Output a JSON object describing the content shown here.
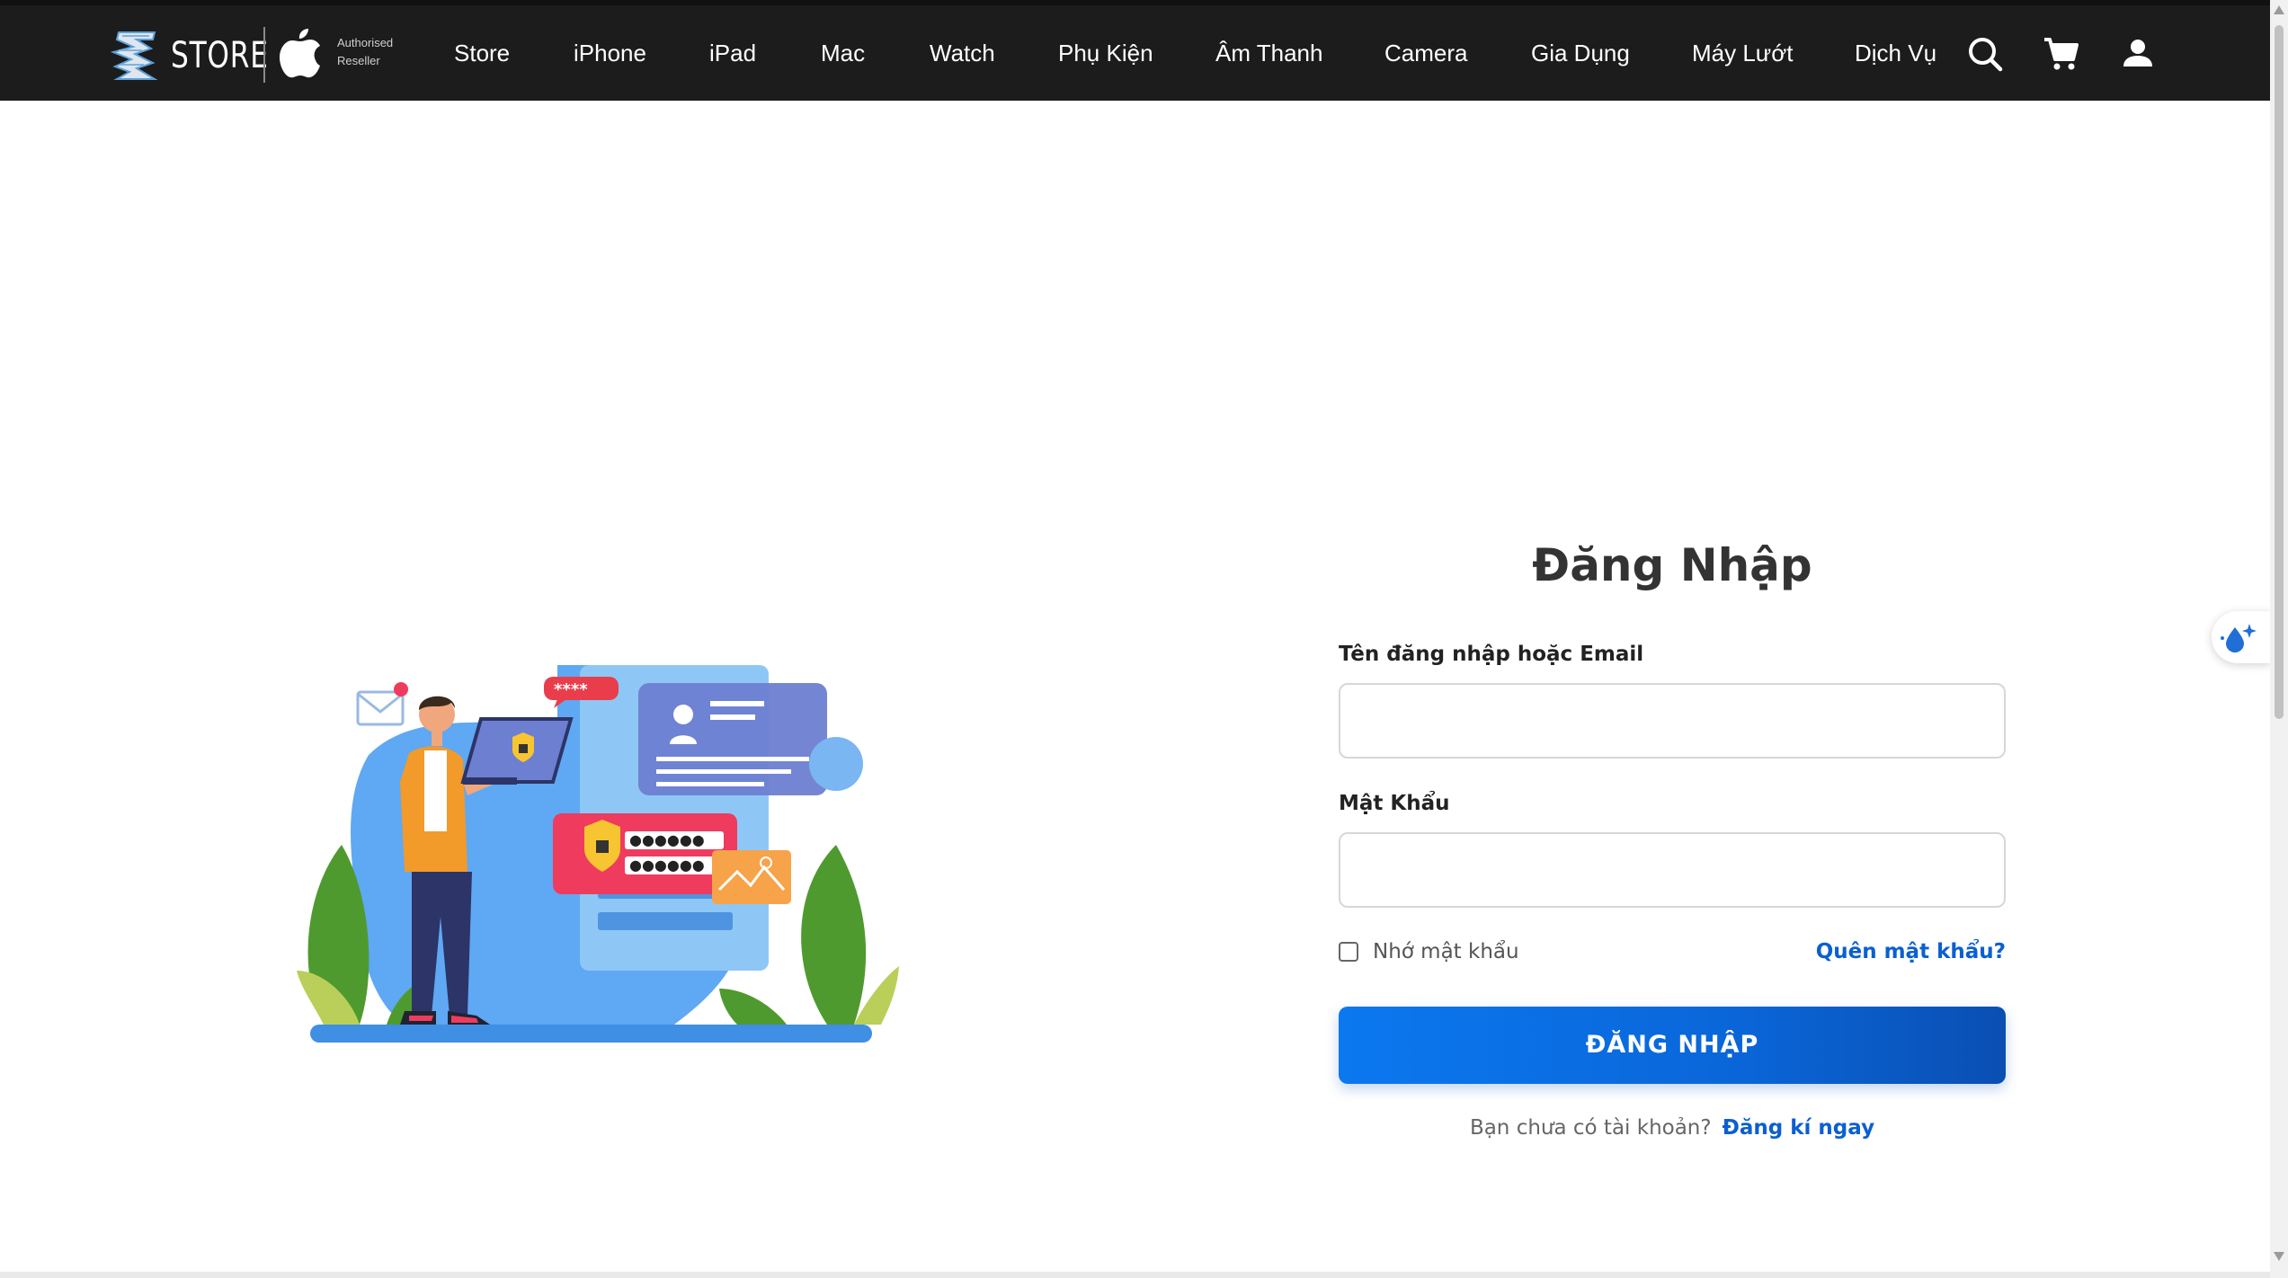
{
  "brand": {
    "store_word": "STORE",
    "reseller_line1": "Authorised",
    "reseller_line2": "Reseller"
  },
  "nav": {
    "items": [
      "Store",
      "iPhone",
      "iPad",
      "Mac",
      "Watch",
      "Phụ Kiện",
      "Âm Thanh",
      "Camera",
      "Gia Dụng",
      "Máy Lướt",
      "Dịch Vụ"
    ],
    "icons": [
      "search-icon",
      "cart-icon",
      "user-icon"
    ]
  },
  "login": {
    "title": "Đăng Nhập",
    "username_label": "Tên đăng nhập hoặc Email",
    "username_value": "",
    "password_label": "Mật Khẩu",
    "password_value": "",
    "remember_label": "Nhớ mật khẩu",
    "remember_checked": false,
    "forgot_label": "Quên mật khẩu?",
    "submit_label": "ĐĂNG NHẬP",
    "signup_question": "Bạn chưa có tài khoản?",
    "signup_link": "Đăng kí ngay"
  },
  "illustration": {
    "password_badge": "****"
  },
  "colors": {
    "nav_bg": "#1c1c1c",
    "primary": "#0a66d8",
    "link": "#0b5fd1"
  }
}
